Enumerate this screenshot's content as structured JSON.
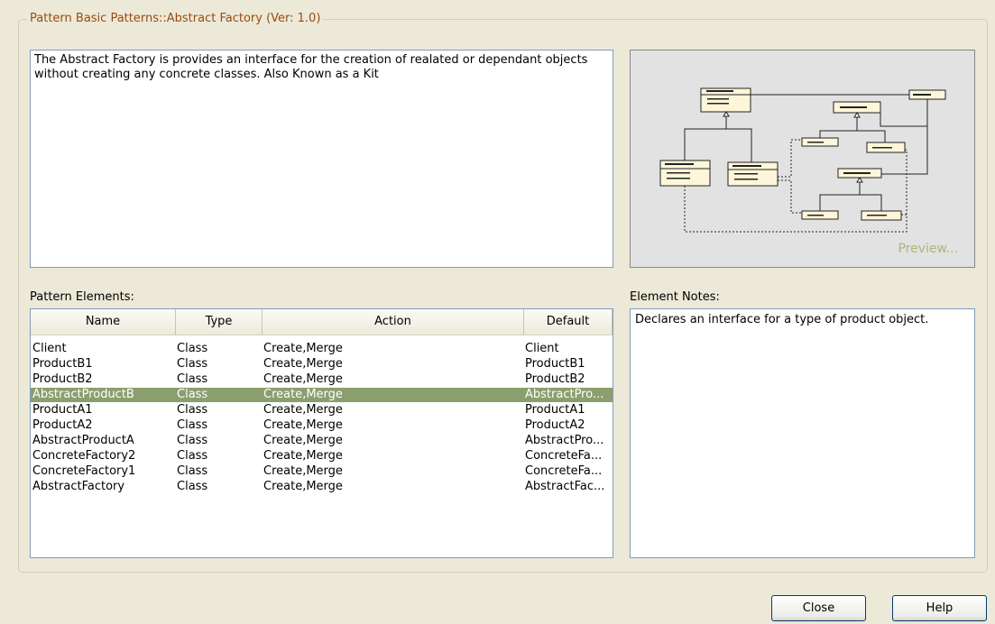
{
  "dialog": {
    "group_title": "Pattern Basic Patterns::Abstract Factory (Ver: 1.0)",
    "description": "The Abstract Factory is provides an interface for the creation of realated or dependant objects without creating any concrete classes. Also Known as a Kit",
    "preview_label": "Preview...",
    "elements_label": "Pattern Elements:",
    "notes_label": "Element Notes:",
    "notes_text": "Declares an interface for a type of product object.",
    "close_label": "Close",
    "help_label": "Help"
  },
  "table": {
    "columns": [
      "Name",
      "Type",
      "Action",
      "Default"
    ],
    "rows": [
      {
        "name": "Client",
        "type": "Class",
        "action": "Create,Merge",
        "default": "Client"
      },
      {
        "name": "ProductB1",
        "type": "Class",
        "action": "Create,Merge",
        "default": "ProductB1"
      },
      {
        "name": "ProductB2",
        "type": "Class",
        "action": "Create,Merge",
        "default": "ProductB2"
      },
      {
        "name": "AbstractProductB",
        "type": "Class",
        "action": "Create,Merge",
        "default": "AbstractPro..."
      },
      {
        "name": "ProductA1",
        "type": "Class",
        "action": "Create,Merge",
        "default": "ProductA1"
      },
      {
        "name": "ProductA2",
        "type": "Class",
        "action": "Create,Merge",
        "default": "ProductA2"
      },
      {
        "name": "AbstractProductA",
        "type": "Class",
        "action": "Create,Merge",
        "default": "AbstractPro..."
      },
      {
        "name": "ConcreteFactory2",
        "type": "Class",
        "action": "Create,Merge",
        "default": "ConcreteFa..."
      },
      {
        "name": "ConcreteFactory1",
        "type": "Class",
        "action": "Create,Merge",
        "default": "ConcreteFa..."
      },
      {
        "name": "AbstractFactory",
        "type": "Class",
        "action": "Create,Merge",
        "default": "AbstractFac..."
      }
    ],
    "selected_index": 3
  },
  "colors": {
    "legend": "#9c4a0f",
    "selection": "#8b9f6e",
    "preview_bg": "#e2e2e2",
    "preview_text": "#a9b878",
    "class_box": "#fff6d9"
  }
}
